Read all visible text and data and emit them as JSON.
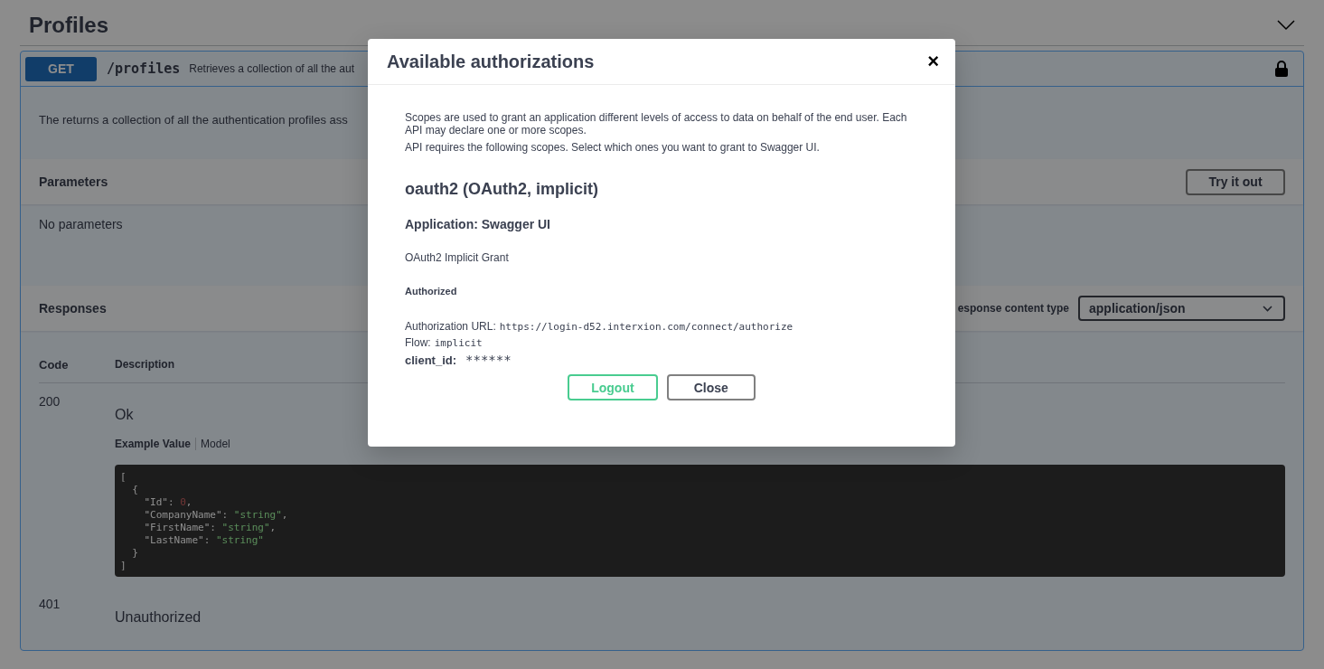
{
  "section": {
    "title": "Profiles",
    "expanded": true
  },
  "operation": {
    "method": "GET",
    "path": "/profiles",
    "summary": "Retrieves a collection of all the aut",
    "locked": true,
    "description": "The returns a collection of all the authentication profiles ass",
    "parameters": {
      "title": "Parameters",
      "try_button": "Try it out",
      "empty_text": "No parameters"
    },
    "responses": {
      "title": "Responses",
      "content_type_label": "esponse content type",
      "content_type": "application/json",
      "columns": [
        "Code",
        "Description"
      ],
      "rows": [
        {
          "code": "200",
          "description": "Ok",
          "tabs": [
            {
              "label": "Example Value",
              "selected": true
            },
            {
              "label": "Model",
              "selected": false
            }
          ],
          "example": [
            {
              "kind": "punct",
              "text": "["
            },
            {
              "kind": "punct",
              "text": "  {"
            },
            {
              "kind": "number",
              "key": "    \"Id\"",
              "sep": ": ",
              "value": "0",
              "suffix": ","
            },
            {
              "kind": "string",
              "key": "    \"CompanyName\"",
              "sep": ": ",
              "value": "\"string\"",
              "suffix": ","
            },
            {
              "kind": "string",
              "key": "    \"FirstName\"",
              "sep": ": ",
              "value": "\"string\"",
              "suffix": ","
            },
            {
              "kind": "string",
              "key": "    \"LastName\"",
              "sep": ": ",
              "value": "\"string\""
            },
            {
              "kind": "punct",
              "text": "  }"
            },
            {
              "kind": "punct",
              "text": "]"
            }
          ]
        },
        {
          "code": "401",
          "description": "Unauthorized"
        }
      ]
    }
  },
  "modal": {
    "title": "Available authorizations",
    "close": "×",
    "intro": [
      "Scopes are used to grant an application different levels of access to data on behalf of the end user. Each API may declare one or more scopes.",
      "API requires the following scopes. Select which ones you want to grant to Swagger UI."
    ],
    "scheme_title": "oauth2 (OAuth2, implicit)",
    "application": "Application: Swagger UI",
    "grant": "OAuth2 Implicit Grant",
    "status": "Authorized",
    "fields": [
      {
        "label": "Authorization URL:",
        "value": "https://login-d52.interxion.com/connect/authorize"
      },
      {
        "label": "Flow:",
        "value": "implicit"
      }
    ],
    "client_id": {
      "label": "client_id:",
      "value": "******"
    },
    "buttons": [
      {
        "label": "Logout",
        "kind": "authorize"
      },
      {
        "label": "Close",
        "kind": "close"
      }
    ]
  }
}
